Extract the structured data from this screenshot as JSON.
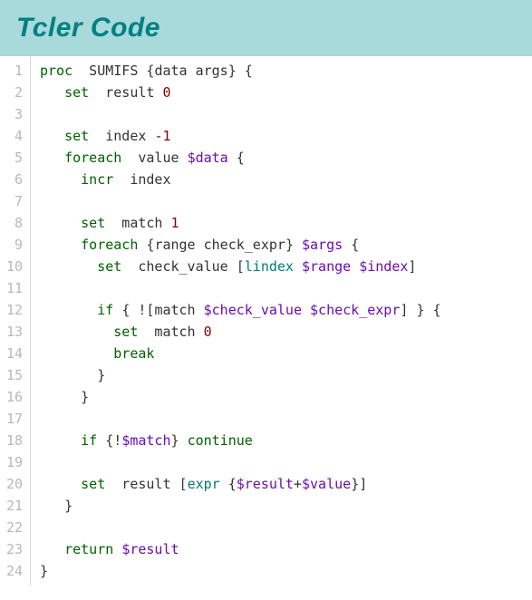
{
  "header": {
    "title": "Tcler Code"
  },
  "code": {
    "lineNumbers": [
      "1",
      "2",
      "3",
      "4",
      "5",
      "6",
      "7",
      "8",
      "9",
      "10",
      "11",
      "12",
      "13",
      "14",
      "15",
      "16",
      "17",
      "18",
      "19",
      "20",
      "21",
      "22",
      "23",
      "24"
    ],
    "lines": [
      [
        [
          "kw",
          "proc"
        ],
        [
          "",
          "  SUMIFS "
        ],
        [
          "br",
          "{"
        ],
        [
          "",
          "data args"
        ],
        [
          "br",
          "}"
        ],
        [
          "",
          " "
        ],
        [
          "br",
          "{"
        ]
      ],
      [
        [
          "",
          "   "
        ],
        [
          "kw",
          "set"
        ],
        [
          "",
          "  result "
        ],
        [
          "num",
          "0"
        ]
      ],
      [
        [
          "",
          ""
        ]
      ],
      [
        [
          "",
          "   "
        ],
        [
          "kw",
          "set"
        ],
        [
          "",
          "  index "
        ],
        [
          "num",
          "-1"
        ]
      ],
      [
        [
          "",
          "   "
        ],
        [
          "kw",
          "foreach"
        ],
        [
          "",
          "  value "
        ],
        [
          "var",
          "$data"
        ],
        [
          "",
          " "
        ],
        [
          "br",
          "{"
        ]
      ],
      [
        [
          "",
          "     "
        ],
        [
          "kw",
          "incr"
        ],
        [
          "",
          "  index"
        ]
      ],
      [
        [
          "",
          ""
        ]
      ],
      [
        [
          "",
          "     "
        ],
        [
          "kw",
          "set"
        ],
        [
          "",
          "  match "
        ],
        [
          "num",
          "1"
        ]
      ],
      [
        [
          "",
          "     "
        ],
        [
          "kw",
          "foreach"
        ],
        [
          "",
          " "
        ],
        [
          "br",
          "{"
        ],
        [
          "",
          "range check_expr"
        ],
        [
          "br",
          "}"
        ],
        [
          "",
          " "
        ],
        [
          "var",
          "$args"
        ],
        [
          "",
          " "
        ],
        [
          "br",
          "{"
        ]
      ],
      [
        [
          "",
          "       "
        ],
        [
          "kw",
          "set"
        ],
        [
          "",
          "  check_value "
        ],
        [
          "br",
          "["
        ],
        [
          "cmd",
          "lindex"
        ],
        [
          "",
          " "
        ],
        [
          "var",
          "$range"
        ],
        [
          "",
          " "
        ],
        [
          "var",
          "$index"
        ],
        [
          "br",
          "]"
        ]
      ],
      [
        [
          "",
          ""
        ]
      ],
      [
        [
          "",
          "       "
        ],
        [
          "kw",
          "if"
        ],
        [
          "",
          " "
        ],
        [
          "br",
          "{"
        ],
        [
          "",
          " "
        ],
        [
          "op",
          "!"
        ],
        [
          "br",
          "["
        ],
        [
          "",
          "match "
        ],
        [
          "var",
          "$check_value"
        ],
        [
          "",
          " "
        ],
        [
          "var",
          "$check_expr"
        ],
        [
          "br",
          "]"
        ],
        [
          "",
          " "
        ],
        [
          "br",
          "}"
        ],
        [
          "",
          " "
        ],
        [
          "br",
          "{"
        ]
      ],
      [
        [
          "",
          "         "
        ],
        [
          "kw",
          "set"
        ],
        [
          "",
          "  match "
        ],
        [
          "num",
          "0"
        ]
      ],
      [
        [
          "",
          "         "
        ],
        [
          "kw",
          "break"
        ]
      ],
      [
        [
          "",
          "       "
        ],
        [
          "br",
          "}"
        ]
      ],
      [
        [
          "",
          "     "
        ],
        [
          "br",
          "}"
        ]
      ],
      [
        [
          "",
          ""
        ]
      ],
      [
        [
          "",
          "     "
        ],
        [
          "kw",
          "if"
        ],
        [
          "",
          " "
        ],
        [
          "br",
          "{"
        ],
        [
          "op",
          "!"
        ],
        [
          "var",
          "$match"
        ],
        [
          "br",
          "}"
        ],
        [
          "",
          " "
        ],
        [
          "kw",
          "continue"
        ]
      ],
      [
        [
          "",
          ""
        ]
      ],
      [
        [
          "",
          "     "
        ],
        [
          "kw",
          "set"
        ],
        [
          "",
          "  result "
        ],
        [
          "br",
          "["
        ],
        [
          "cmd",
          "expr"
        ],
        [
          "",
          " "
        ],
        [
          "br",
          "{"
        ],
        [
          "var",
          "$result"
        ],
        [
          "op",
          "+"
        ],
        [
          "var",
          "$value"
        ],
        [
          "br",
          "}"
        ],
        [
          "br",
          "]"
        ]
      ],
      [
        [
          "",
          "   "
        ],
        [
          "br",
          "}"
        ]
      ],
      [
        [
          "",
          ""
        ]
      ],
      [
        [
          "",
          "   "
        ],
        [
          "kw",
          "return"
        ],
        [
          "",
          " "
        ],
        [
          "var",
          "$result"
        ]
      ],
      [
        [
          "br",
          "}"
        ]
      ]
    ]
  }
}
